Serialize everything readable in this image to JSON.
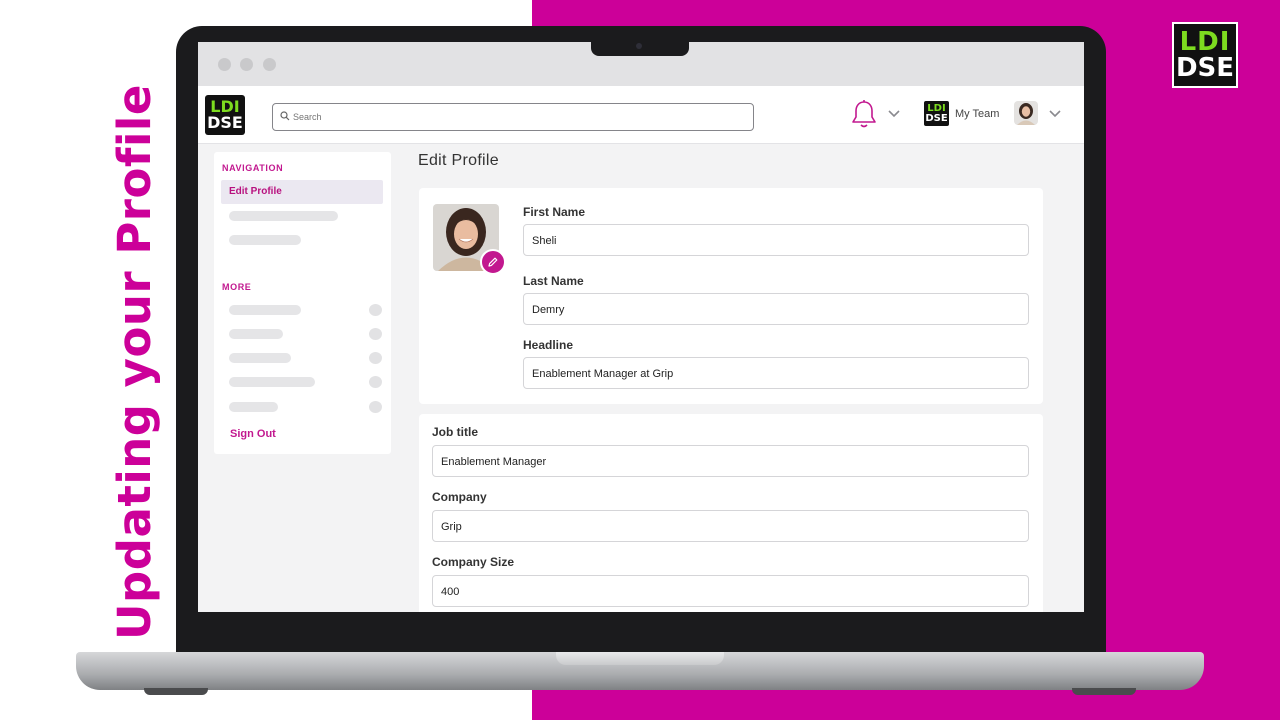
{
  "overlay": {
    "side_title": "Updating your Profile",
    "brand_logo": {
      "line1": "LDI",
      "line2": "DSE"
    }
  },
  "colors": {
    "accent": "#cc0099",
    "brand_green": "#7ddc1f",
    "nav_accent": "#c2188f"
  },
  "header": {
    "logo": {
      "line1": "LDI",
      "line2": "DSE"
    },
    "search": {
      "placeholder": "Search",
      "value": ""
    },
    "notifications_icon": "bell-icon",
    "team": {
      "logo": {
        "line1": "LDI",
        "line2": "DSE"
      },
      "label": "My Team"
    }
  },
  "sidebar": {
    "navigation_heading": "NAVIGATION",
    "active_item": "Edit Profile",
    "more_heading": "MORE",
    "sign_out": "Sign Out"
  },
  "main": {
    "page_title": "Edit Profile",
    "fields": {
      "first_name": {
        "label": "First Name",
        "value": "Sheli"
      },
      "last_name": {
        "label": "Last Name",
        "value": "Demry"
      },
      "headline": {
        "label": "Headline",
        "value": "Enablement Manager at Grip"
      },
      "job_title": {
        "label": "Job title",
        "value": "Enablement Manager"
      },
      "company": {
        "label": "Company",
        "value": "Grip"
      },
      "company_size": {
        "label": "Company Size",
        "value": "400"
      }
    }
  }
}
